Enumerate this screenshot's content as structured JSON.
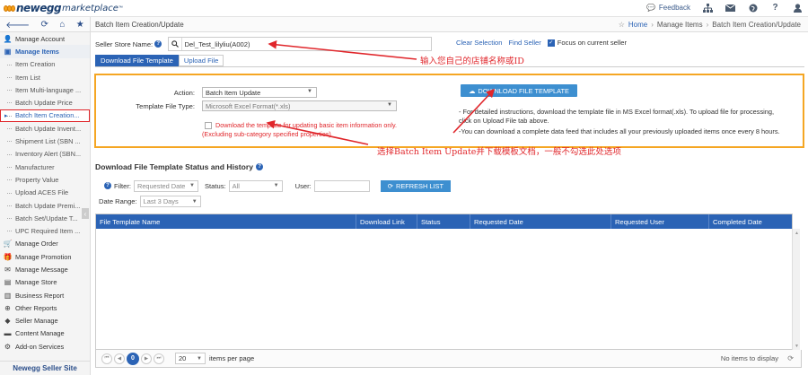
{
  "topbar": {
    "logo_main": "newegg",
    "logo_sub": "marketplace",
    "logo_tm": "™",
    "feedback": "Feedback"
  },
  "subbar": {
    "page_title": "Batch Item Creation/Update",
    "breadcrumb": [
      "Home",
      "Manage Items",
      "Batch Item Creation/Update"
    ]
  },
  "sidebar": {
    "items": [
      {
        "label": "Manage Account",
        "icon": "user-icon",
        "glyph": "👤",
        "kind": "top"
      },
      {
        "label": "Manage Items",
        "icon": "items-icon",
        "glyph": "▣",
        "kind": "head"
      },
      {
        "label": "Item Creation",
        "kind": "sub"
      },
      {
        "label": "Item List",
        "kind": "sub"
      },
      {
        "label": "Item Multi-language ...",
        "kind": "sub"
      },
      {
        "label": "Batch Update Price",
        "kind": "sub"
      },
      {
        "label": "Batch Item Creation...",
        "kind": "active"
      },
      {
        "label": "Batch Update Invent...",
        "kind": "sub"
      },
      {
        "label": "Shipment List (SBN ...",
        "kind": "sub"
      },
      {
        "label": "Inventory Alert (SBN...",
        "kind": "sub"
      },
      {
        "label": "Manufacturer",
        "kind": "sub"
      },
      {
        "label": "Property Value",
        "kind": "sub"
      },
      {
        "label": "Upload ACES File",
        "kind": "sub"
      },
      {
        "label": "Batch Update Premi...",
        "kind": "sub"
      },
      {
        "label": "Batch Set/Update T...",
        "kind": "sub"
      },
      {
        "label": "UPC Required Item ...",
        "kind": "sub"
      },
      {
        "label": "Manage Order",
        "icon": "cart-icon",
        "glyph": "🛒",
        "kind": "top"
      },
      {
        "label": "Manage Promotion",
        "icon": "gift-icon",
        "glyph": "🎁",
        "kind": "top"
      },
      {
        "label": "Manage Message",
        "icon": "envelope-icon",
        "glyph": "✉",
        "kind": "top"
      },
      {
        "label": "Manage Store",
        "icon": "store-icon",
        "glyph": "▤",
        "kind": "top"
      },
      {
        "label": "Business Report",
        "icon": "bar-chart-icon",
        "glyph": "▥",
        "kind": "top"
      },
      {
        "label": "Other Reports",
        "icon": "globe-icon",
        "glyph": "⊕",
        "kind": "top"
      },
      {
        "label": "Seller Manage",
        "icon": "tag-icon",
        "glyph": "◆",
        "kind": "top"
      },
      {
        "label": "Content Manage",
        "icon": "folder-icon",
        "glyph": "▬",
        "kind": "top"
      },
      {
        "label": "Add-on Services",
        "icon": "gears-icon",
        "glyph": "⚙",
        "kind": "top"
      }
    ],
    "footer": "Newegg Seller Site"
  },
  "store": {
    "label": "Seller Store Name:",
    "value": "Del_Test_lilyliu(A002)",
    "clear_selection": "Clear Selection",
    "find_seller": "Find Seller",
    "focus_label": "Focus on current seller",
    "focus_checked": true
  },
  "tabs": [
    "Download File Template",
    "Upload File"
  ],
  "form": {
    "action_label": "Action:",
    "action_value": "Batch Item Update",
    "template_label": "Template File Type:",
    "template_value": "Microsoft Excel Format(*.xls)",
    "checkbox_line1": "Download the template for updating basic item information only.",
    "checkbox_line2": "(Excluding sub-category specified properties)",
    "download_button": "DOWNLOAD FILE TEMPLATE",
    "notes": [
      "- For detailed instructions, download the template file in MS Excel format(.xls). To upload file for processing,",
      "click on Upload File tab above.",
      "-You can download a complete data feed that includes all your previously uploaded items once every 8 hours."
    ]
  },
  "annotations": {
    "store_hint": "输入您自己的店铺名称或ID",
    "template_hint": "选择Batch Item Update并下载模板文档，一般不勾选此处选项"
  },
  "history": {
    "title": "Download File Template Status and History",
    "filter_label": "Filter:",
    "filter_value": "Requested Date",
    "status_label": "Status:",
    "status_value": "All",
    "user_label": "User:",
    "user_value": "",
    "refresh_button": "REFRESH LIST",
    "date_range_label": "Date Range:",
    "date_range_value": "Last 3 Days",
    "columns": [
      "File Template Name",
      "Download Link",
      "Status",
      "Requested Date",
      "Requested User",
      "Completed Date"
    ],
    "rows": [],
    "pager": {
      "current": "0",
      "per_page": "20",
      "per_page_label": "items per page",
      "empty": "No items to display"
    }
  },
  "colors": {
    "accent": "#2b63b5",
    "button": "#3d8fd0",
    "highlight_border": "#f5a623",
    "annotation": "#e0262b"
  }
}
